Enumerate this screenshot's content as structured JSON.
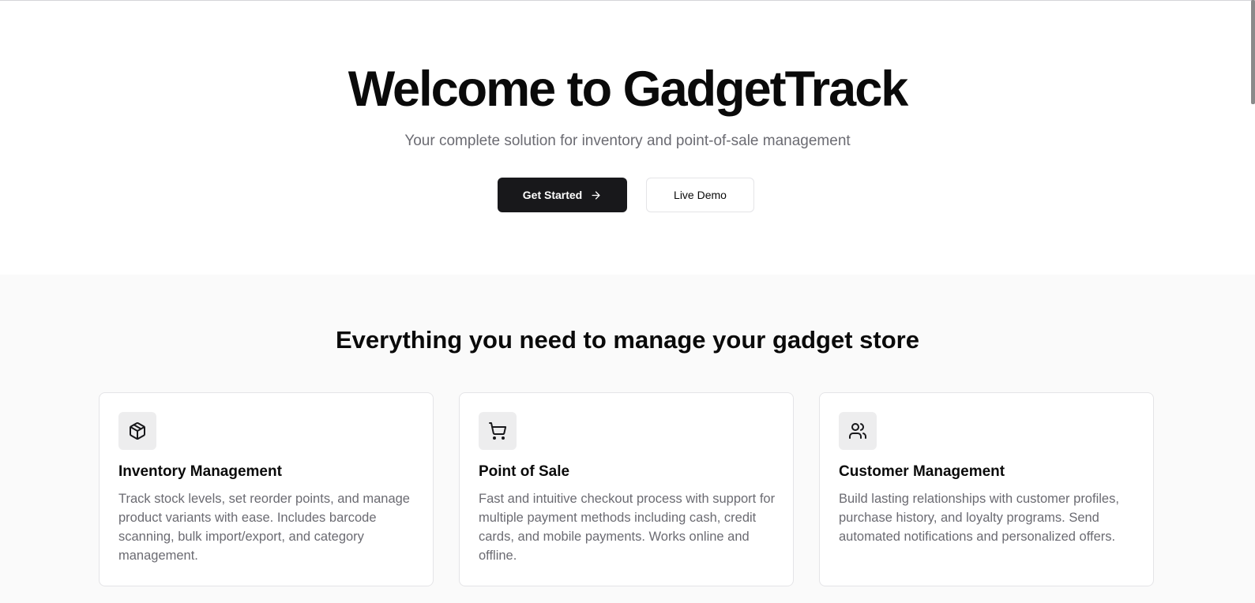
{
  "hero": {
    "title": "Welcome to GadgetTrack",
    "subtitle": "Your complete solution for inventory and point-of-sale management",
    "primary_button": "Get Started",
    "primary_button_icon": "arrow-right-icon",
    "secondary_button": "Live Demo"
  },
  "features": {
    "title": "Everything you need to manage your gadget store",
    "cards": [
      {
        "icon": "package-icon",
        "title": "Inventory Management",
        "description": "Track stock levels, set reorder points, and manage product variants with ease. Includes barcode scanning, bulk import/export, and category management."
      },
      {
        "icon": "shopping-cart-icon",
        "title": "Point of Sale",
        "description": "Fast and intuitive checkout process with support for multiple payment methods including cash, credit cards, and mobile payments. Works online and offline."
      },
      {
        "icon": "users-icon",
        "title": "Customer Management",
        "description": "Build lasting relationships with customer profiles, purchase history, and loyalty programs. Send automated notifications and personalized offers."
      }
    ]
  },
  "colors": {
    "primary_button_bg": "#18181b",
    "page_bg": "#fafafa",
    "muted_text": "#6b6b72",
    "icon_tile_bg": "#ededee"
  }
}
